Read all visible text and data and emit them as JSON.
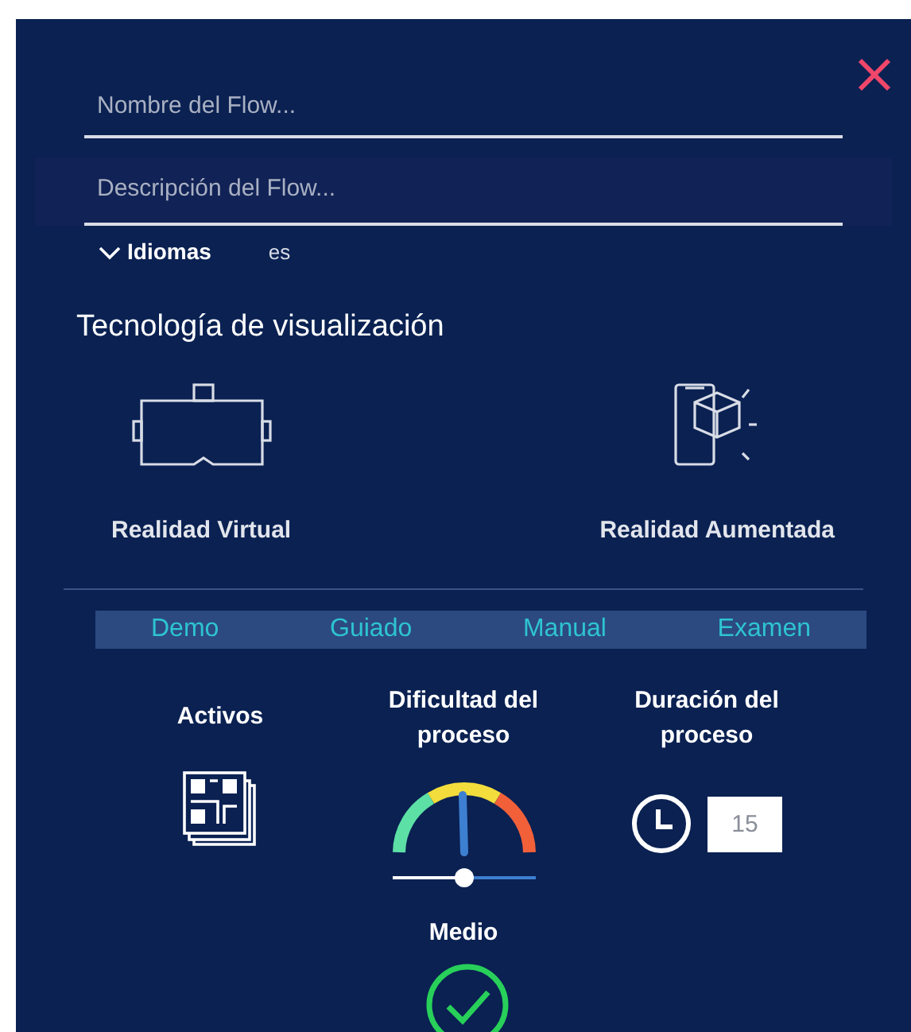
{
  "close": {
    "kind": "close"
  },
  "name_field": {
    "placeholder": "Nombre del Flow..."
  },
  "description_field": {
    "placeholder": "Descripción del Flow..."
  },
  "languages": {
    "label": "Idiomas",
    "value": "es",
    "expanded": false
  },
  "visualization": {
    "title": "Tecnología de visualización",
    "options": [
      {
        "kind": "vr",
        "label": "Realidad Virtual"
      },
      {
        "kind": "ar",
        "label": "Realidad Aumentada"
      }
    ]
  },
  "modes": [
    {
      "label": "Demo",
      "selected": false
    },
    {
      "label": "Guiado",
      "selected": false
    },
    {
      "label": "Manual",
      "selected": false
    },
    {
      "label": "Examen",
      "selected": false
    }
  ],
  "assets": {
    "label": "Activos"
  },
  "difficulty": {
    "label": "Dificultad del proceso",
    "reading": "Medio"
  },
  "duration": {
    "label": "Duración del proceso",
    "value": "15"
  }
}
